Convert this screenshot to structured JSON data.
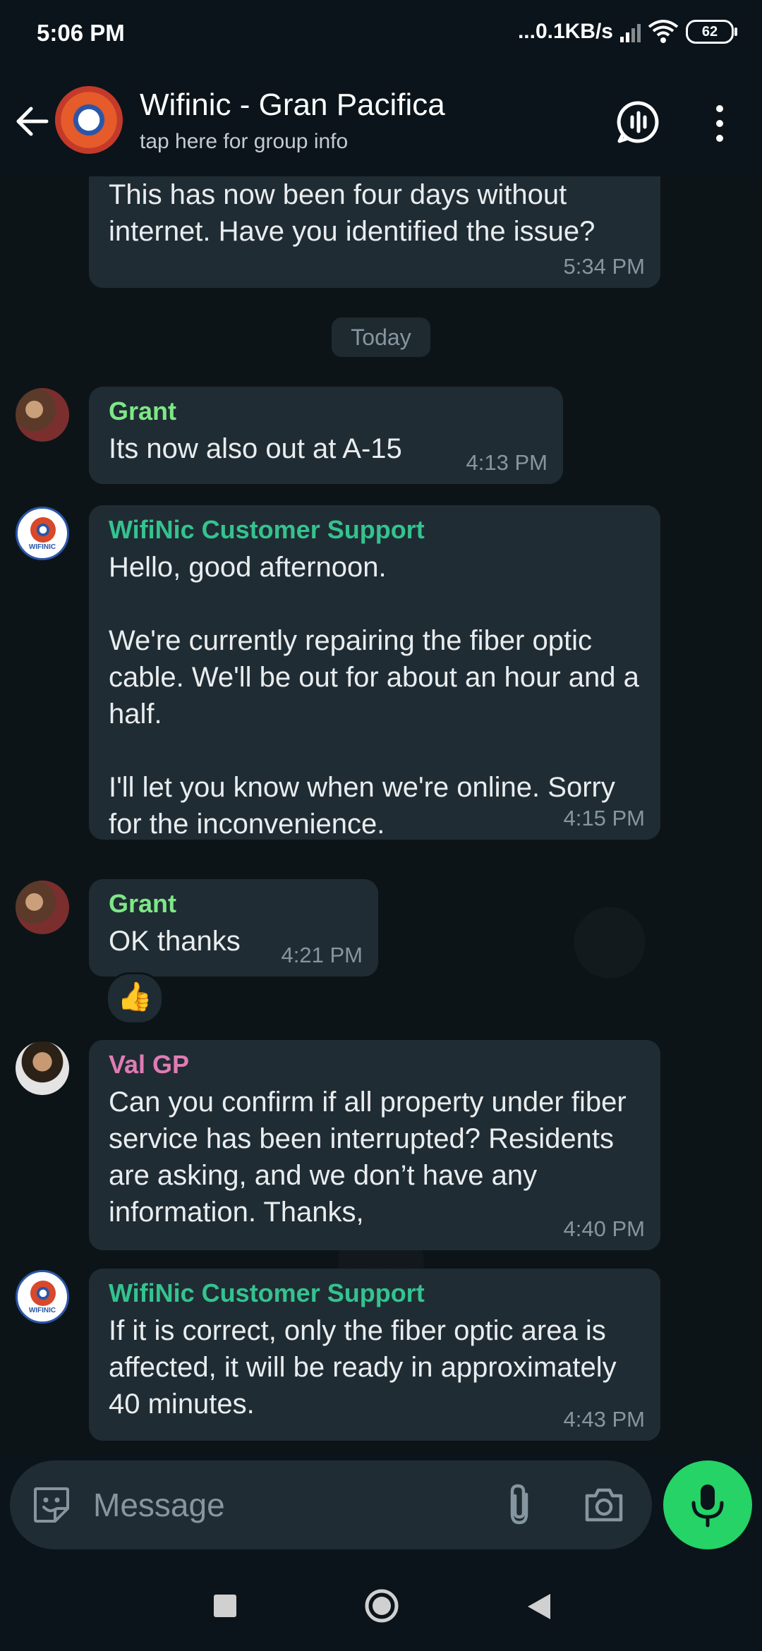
{
  "status_bar": {
    "time": "5:06 PM",
    "network_speed": "...0.1KB/s",
    "battery": "62"
  },
  "header": {
    "title": "Wifinic - Gran Pacifica",
    "subtitle": "tap here for group info"
  },
  "chat": {
    "day_separator": "Today",
    "messages": [
      {
        "sender": "",
        "text": "This has now been four days without internet. Have you identified the issue?",
        "time": "5:34 PM"
      },
      {
        "sender": "Grant",
        "sender_color": "#7ee787",
        "text": "Its now also out at A-15",
        "time": "4:13 PM"
      },
      {
        "sender": "WifiNic Customer Support",
        "sender_color": "#34c38f",
        "text": "Hello, good afternoon.\n\nWe're currently repairing the fiber optic cable. We'll be out for about an hour and a half.\n\nI'll let you know when we're online. Sorry for the inconvenience.",
        "time": "4:15 PM"
      },
      {
        "sender": "Grant",
        "sender_color": "#7ee787",
        "text": "OK thanks",
        "time": "4:21 PM",
        "reaction": "👍"
      },
      {
        "sender": "Val GP",
        "sender_color": "#e07bb5",
        "text": "Can you confirm if all property under fiber service has been interrupted? Residents are asking, and we don’t have any information. Thanks,",
        "time": "4:40 PM"
      },
      {
        "sender": "WifiNic Customer Support",
        "sender_color": "#34c38f",
        "text": "If it is correct, only the fiber optic area is affected, it will be ready in approximately 40 minutes.",
        "time": "4:43 PM"
      }
    ]
  },
  "input": {
    "placeholder": "Message"
  },
  "avatars": {
    "wifinic_label": "WIFINIC"
  },
  "colors": {
    "accent_green": "#25d366",
    "bubble": "#202c33",
    "background": "#0b141a"
  }
}
